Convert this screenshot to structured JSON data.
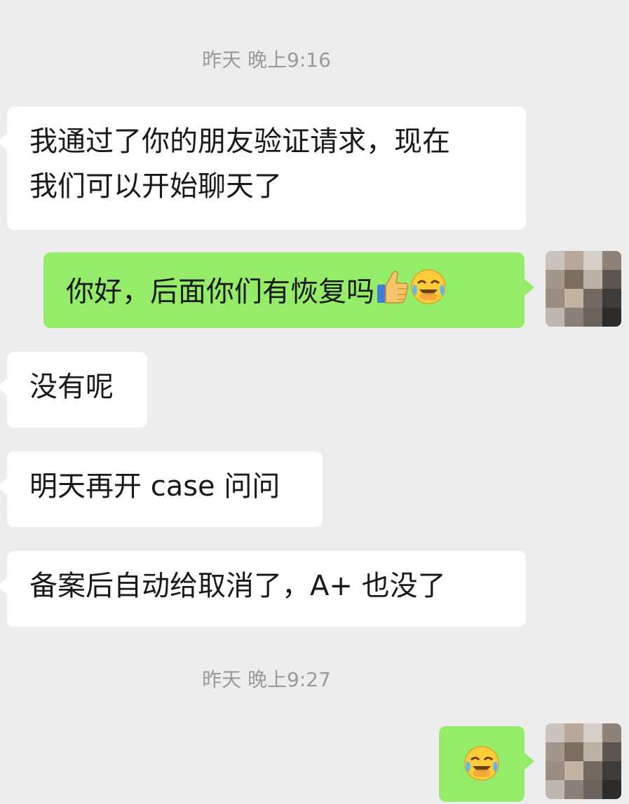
{
  "messages": [
    {
      "type": "time",
      "text": "昨天 晚上9:16"
    },
    {
      "type": "in",
      "line1": "我通过了你的朋友验证请求，现在",
      "line2": "我们可以开始聊天了"
    },
    {
      "type": "out",
      "text": "你好，后面你们有恢复吗",
      "emojis": [
        "thumbs-up-icon",
        "crying-laughing-icon"
      ]
    },
    {
      "type": "in",
      "text": "没有呢"
    },
    {
      "type": "in",
      "text": "明天再开 case 问问"
    },
    {
      "type": "in",
      "text": "备案后自动给取消了，A+ 也没了"
    },
    {
      "type": "time",
      "text": "昨天 晚上9:27"
    },
    {
      "type": "out",
      "text": "",
      "emojis": [
        "crying-laughing-icon"
      ]
    }
  ],
  "colors": {
    "background": "#ededed",
    "incoming_bubble": "#ffffff",
    "outgoing_bubble": "#95ec69",
    "timestamp_text": "#9a9a9a"
  }
}
